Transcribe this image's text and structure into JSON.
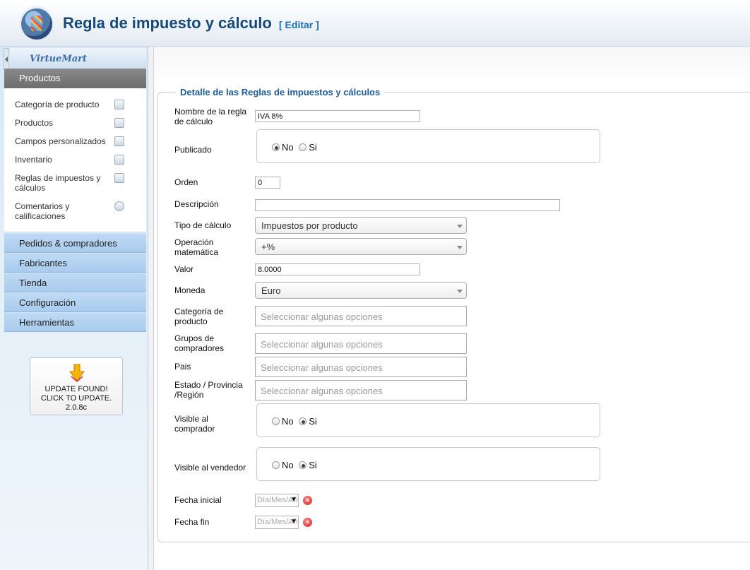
{
  "header": {
    "title": "Regla de impuesto y cálculo",
    "edit_label": "[ Editar ]"
  },
  "sidebar": {
    "brand": "VirtueMart",
    "active_section": "Productos",
    "items": [
      {
        "label": "Categoría de producto",
        "icon": "folder-icon"
      },
      {
        "label": "Productos",
        "icon": "camera-icon"
      },
      {
        "label": "Campos personalizados",
        "icon": "document-icon"
      },
      {
        "label": "Inventario",
        "icon": "chart-icon"
      },
      {
        "label": "Reglas de impuestos y cálculos",
        "icon": "calculator-icon"
      },
      {
        "label": "Comentarios y calificaciones",
        "icon": "speech-bubble-icon"
      }
    ],
    "sections": [
      "Pedidos & compradores",
      "Fabricantes",
      "Tienda",
      "Configuración",
      "Herramientas"
    ],
    "update": {
      "line1": "UPDATE FOUND!",
      "line2": "CLICK TO UPDATE.",
      "version": "2.0.8c"
    }
  },
  "form": {
    "legend": "Detalle de las Reglas de impuestos y cálculos",
    "name_label": "Nombre de la regla de cálculo",
    "name_value": "IVA 8%",
    "published_label": "Publicado",
    "published": "No",
    "order_label": "Orden",
    "order_value": "0",
    "description_label": "Descripción",
    "description_value": "",
    "calc_type_label": "Tipo de cálculo",
    "calc_type_value": "Impuestos por producto",
    "math_op_label": "Operación matemática",
    "math_op_value": "+%",
    "value_label": "Valor",
    "value_value": "8.0000",
    "currency_label": "Moneda",
    "currency_value": "Euro",
    "category_label": "Categoría de producto",
    "groups_label": "Grupos de compradores",
    "country_label": "Pais",
    "state_label": "Estado / Provincia /Región",
    "placeholder": "Seleccionar algunas opciones",
    "visible_buyer_label": "Visible al comprador",
    "visible_buyer": "Si",
    "visible_vendor_label": "Visible al vendedor",
    "visible_vendor": "Si",
    "radio_no": "No",
    "radio_si": "Si",
    "start_date_label": "Fecha inicial",
    "end_date_label": "Fecha fin",
    "date_placeholder": "Día/Mes/Año"
  }
}
